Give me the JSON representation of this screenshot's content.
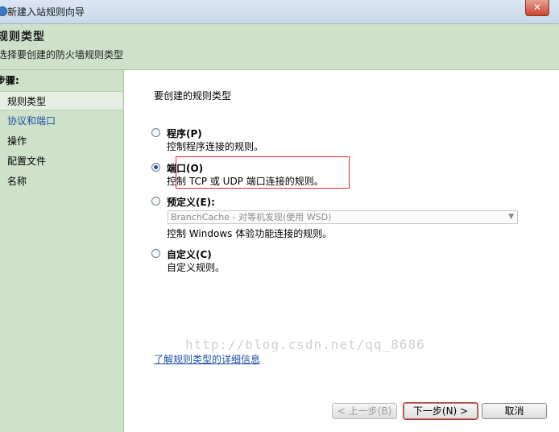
{
  "window": {
    "title": "新建入站规则向导",
    "close_glyph": "✕"
  },
  "header": {
    "title": "规则类型",
    "subtitle": "选择要创建的防火墙规则类型"
  },
  "sidebar": {
    "steps_title": "步骤:",
    "items": [
      {
        "label": "规则类型"
      },
      {
        "label": "协议和端口"
      },
      {
        "label": "操作"
      },
      {
        "label": "配置文件"
      },
      {
        "label": "名称"
      }
    ]
  },
  "main": {
    "prompt": "要创建的规则类型",
    "options": [
      {
        "label": "程序(P)",
        "description": "控制程序连接的规则。",
        "selected": false
      },
      {
        "label": "端口(O)",
        "description": "控制 TCP 或 UDP 端口连接的规则。",
        "selected": true
      },
      {
        "label": "预定义(E):",
        "description": "控制 Windows 体验功能连接的规则。",
        "selected": false
      },
      {
        "label": "自定义(C)",
        "description": "自定义规则。",
        "selected": false
      }
    ],
    "predefined_select": {
      "value": "BranchCache - 对等机发现(使用 WSD)",
      "arrow": "▼"
    },
    "learn_more_link": "了解规则类型的详细信息"
  },
  "buttons": {
    "back": "< 上一步(B)",
    "next": "下一步(N) >",
    "cancel": "取消"
  },
  "watermark": "http://blog.csdn.net/qq_8686"
}
